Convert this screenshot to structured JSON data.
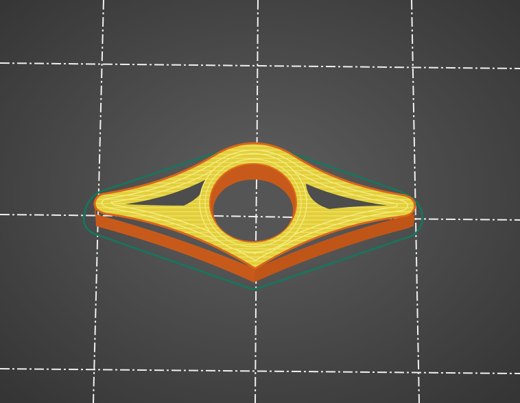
{
  "viewport": {
    "type": "3d-slicer-preview",
    "colors": {
      "background_center": "#5e5e5e",
      "background_edge": "#363636",
      "grid_line": "#f2f2f2",
      "skirt": "#0f7a5e",
      "perimeter_outer": "#d9661a",
      "wall_side": "#c4581a",
      "infill": "#e6d23c",
      "infill_line": "#f4ea7a"
    }
  }
}
